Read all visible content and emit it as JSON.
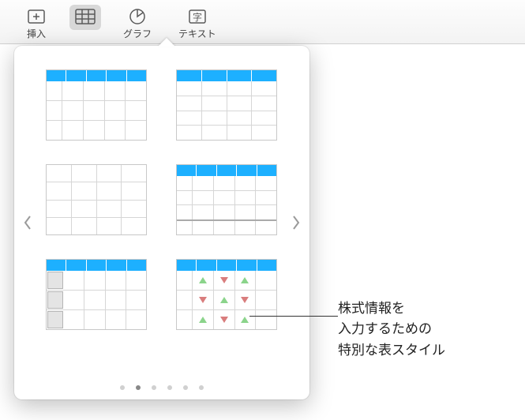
{
  "toolbar": {
    "insert": "挿入",
    "table": "",
    "chart": "グラフ",
    "text": "テキスト"
  },
  "callout": {
    "line1": "株式情報を",
    "line2": "入力するための",
    "line3": "特別な表スタイル"
  },
  "pages": {
    "count": 6,
    "active": 1
  }
}
